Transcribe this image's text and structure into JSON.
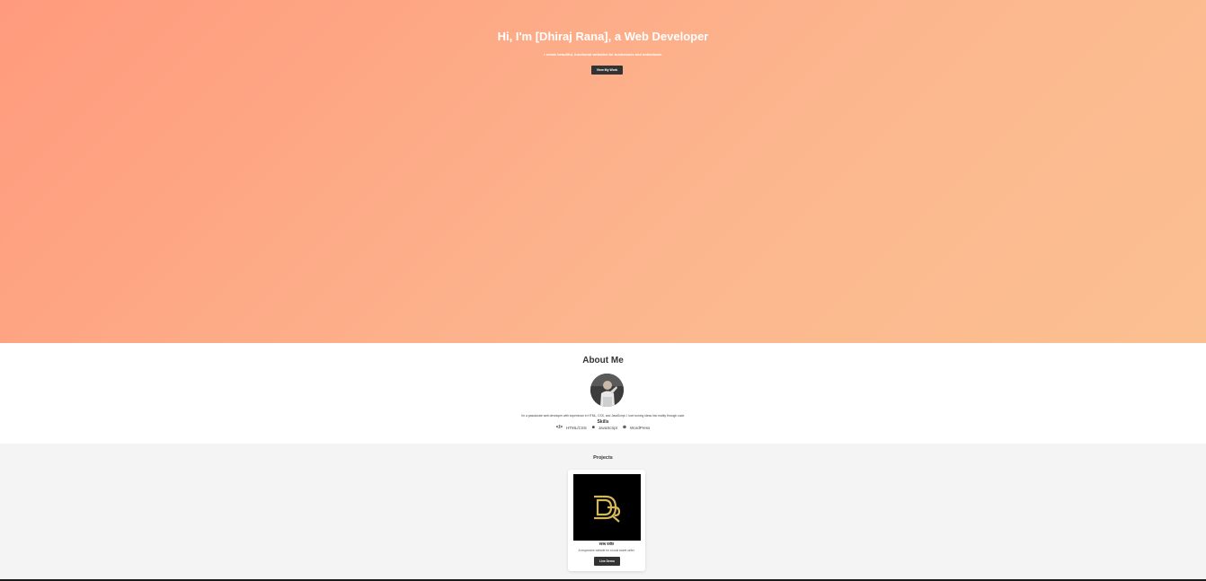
{
  "hero": {
    "title": "Hi, I'm [Dhiraj Rana], a Web Developer",
    "subtitle": "I create beautiful, functional websites for businesses and individuals.",
    "cta_label": "View My Work"
  },
  "about": {
    "title": "About Me",
    "avatar_icon": "person-photo",
    "text": "I'm a passionate web developer with experience in HTML, CSS, and JavaScript. I love turning ideas into reality through code.",
    "skills_title": "Skills",
    "skills": [
      {
        "icon": "code-icon",
        "glyph": "</>",
        "label": "HTML/CSS"
      },
      {
        "icon": "javascript-icon",
        "glyph": "■",
        "label": "JavaScript"
      },
      {
        "icon": "wordpress-icon",
        "glyph": "⊛",
        "label": "WordPress"
      }
    ]
  },
  "projects": {
    "title": "Projects",
    "items": [
      {
        "logo_icon": "dr-logo",
        "title": "स्वस्थ वस्तैत",
        "description": "A responsive website for a local sweet seller.",
        "button_label": "Live Demo"
      }
    ]
  },
  "colors": {
    "hero_gradient_start": "#ff9a7d",
    "hero_gradient_end": "#fbc091",
    "button_dark": "#333333",
    "logo_gold": "#d4b75a",
    "projects_bg": "#f4f4f4"
  }
}
